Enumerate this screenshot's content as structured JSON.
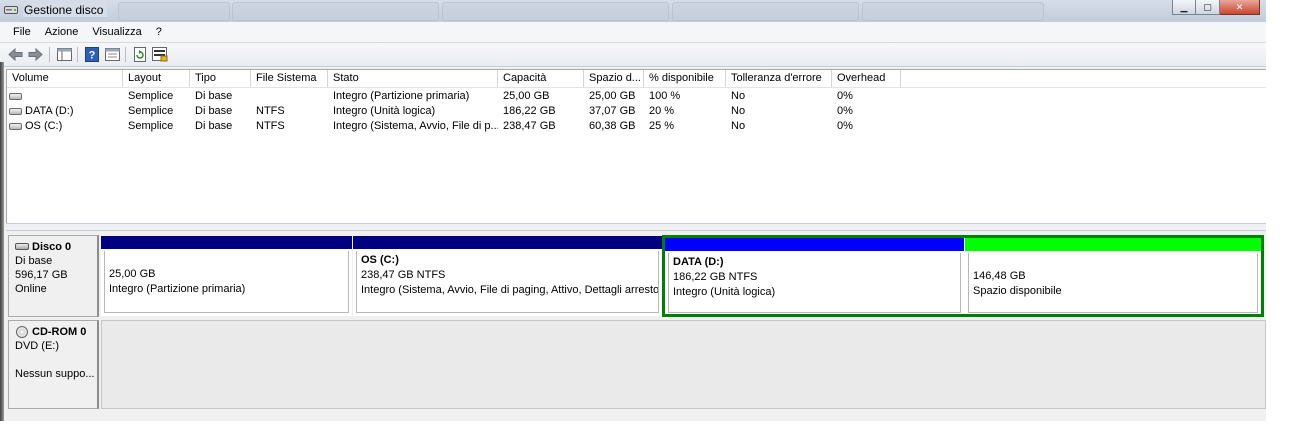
{
  "window": {
    "title": "Gestione disco",
    "buttons": [
      "minimize",
      "maximize",
      "close"
    ]
  },
  "menu": [
    "File",
    "Azione",
    "Visualizza",
    "?"
  ],
  "toolbar": {
    "icons": [
      "back-arrow-icon",
      "forward-arrow-icon",
      "console-tree-icon",
      "help-icon",
      "properties-icon",
      "refresh-icon",
      "rescan-disks-icon"
    ]
  },
  "volume_list": {
    "columns": [
      "Volume",
      "Layout",
      "Tipo",
      "File Sistema",
      "Stato",
      "Capacità",
      "Spazio d...",
      "% disponibile",
      "Tolleranza d'errore",
      "Overhead"
    ],
    "rows": [
      {
        "volume": "",
        "layout": "Semplice",
        "tipo": "Di base",
        "fs": "",
        "stato": "Integro (Partizione primaria)",
        "capacita": "25,00 GB",
        "spazio": "25,00 GB",
        "perc": "100 %",
        "tolleranza": "No",
        "overhead": "0%"
      },
      {
        "volume": "DATA (D:)",
        "layout": "Semplice",
        "tipo": "Di base",
        "fs": "NTFS",
        "stato": "Integro (Unità logica)",
        "capacita": "186,22 GB",
        "spazio": "37,07 GB",
        "perc": "20 %",
        "tolleranza": "No",
        "overhead": "0%"
      },
      {
        "volume": "OS (C:)",
        "layout": "Semplice",
        "tipo": "Di base",
        "fs": "NTFS",
        "stato": "Integro (Sistema, Avvio, File di p...",
        "capacita": "238,47 GB",
        "spazio": "60,38 GB",
        "perc": "25 %",
        "tolleranza": "No",
        "overhead": "0%"
      }
    ]
  },
  "disks": [
    {
      "title": "Disco 0",
      "type": "Di base",
      "size": "596,17 GB",
      "status": "Online",
      "partitions": [
        {
          "name": "",
          "size": "25,00 GB",
          "status": "Integro (Partizione primaria)",
          "bar_color": "#000080",
          "selected": false
        },
        {
          "name": "OS  (C:)",
          "size": "238,47 GB NTFS",
          "status": "Integro (Sistema, Avvio, File di paging, Attivo, Dettagli arresto anomalo, Partizione primaria)",
          "bar_color": "#000080",
          "selected": false
        },
        {
          "name": "DATA  (D:)",
          "size": "186,22 GB NTFS",
          "status": "Integro (Unità logica)",
          "bar_color": "#0000ff",
          "selected": true
        },
        {
          "name": "",
          "size": "146,48 GB",
          "status": "Spazio disponibile",
          "bar_color": "#00ff00",
          "selected": true
        }
      ]
    },
    {
      "title": "CD-ROM 0",
      "type": "DVD (E:)",
      "size": "",
      "status": "Nessun suppo..."
    }
  ],
  "colors": {
    "primary_partition": "#000080",
    "logical_drive": "#0000ff",
    "free_space": "#00ff00",
    "extended_border": "#008000"
  }
}
